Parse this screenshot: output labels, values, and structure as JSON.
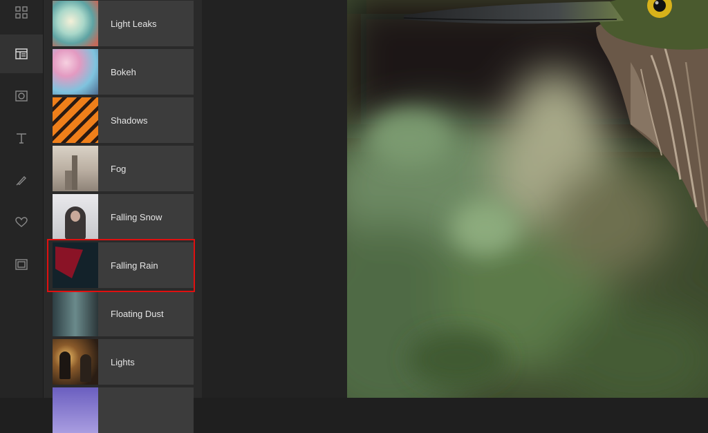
{
  "rail": {
    "items": [
      {
        "icon": "grid-icon",
        "active": false
      },
      {
        "icon": "effects-panel-icon",
        "active": true
      },
      {
        "icon": "frame-circle-icon",
        "active": false
      },
      {
        "icon": "text-icon",
        "active": false
      },
      {
        "icon": "brush-icon",
        "active": false
      },
      {
        "icon": "heart-icon",
        "active": false
      },
      {
        "icon": "border-icon",
        "active": false
      }
    ]
  },
  "effects": {
    "items": [
      {
        "label": "Light Leaks"
      },
      {
        "label": "Bokeh"
      },
      {
        "label": "Shadows"
      },
      {
        "label": "Fog"
      },
      {
        "label": "Falling Snow"
      },
      {
        "label": "Falling Rain",
        "selected": true
      },
      {
        "label": "Floating Dust"
      },
      {
        "label": "Lights"
      }
    ]
  },
  "colors": {
    "highlight": "#e01010",
    "panel": "#2a2a2a",
    "item": "#3c3c3c"
  }
}
